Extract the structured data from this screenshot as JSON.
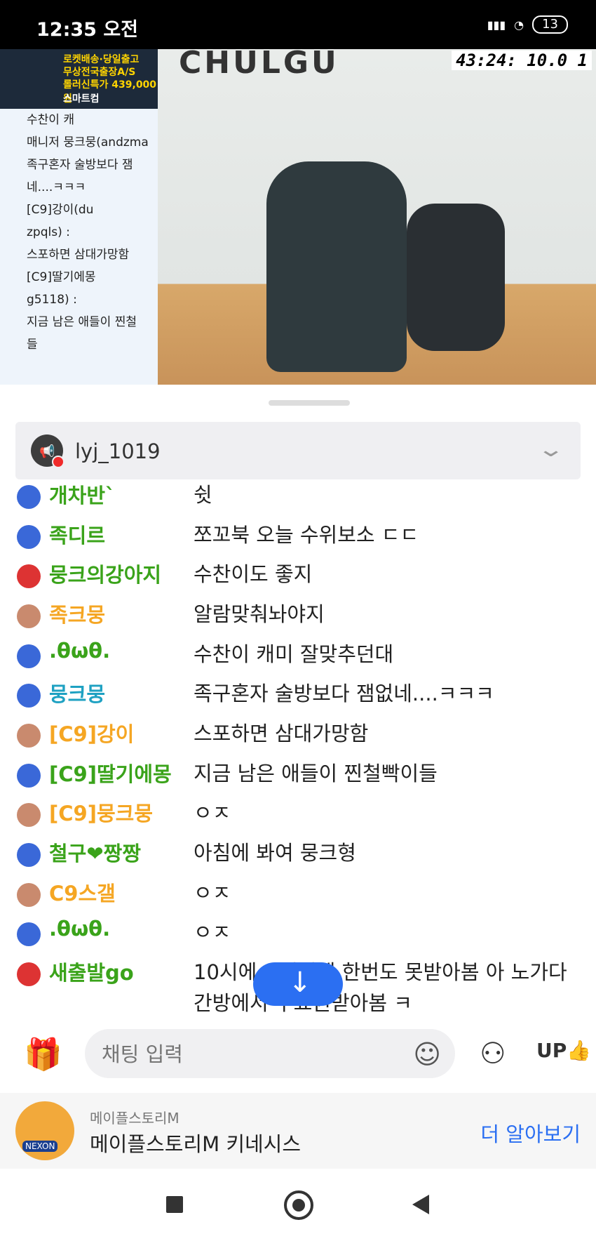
{
  "status": {
    "time": "12:35 오전",
    "battery": "13"
  },
  "video": {
    "ad_lines": [
      "로켓배송·당일출고",
      "무상전국출장A/S",
      "롤러신특가 439,000원",
      "스마트컴"
    ],
    "overlay_chat": [
      "수찬이 캐",
      "매니저 뭉크뭉(andzma",
      "족구혼자 술방보다 잼",
      "네....ㅋㅋㅋ",
      "[C9]강이(du",
      "zpqls) :",
      "스포하면 삼대가망함",
      "[C9]딸기에몽",
      "g5118) :",
      "지금 남은 애들이 찐철",
      "들"
    ],
    "brand": "CHULGU",
    "timer": "43:24: 10.0 1"
  },
  "owner": {
    "name": "lyj_1019"
  },
  "chat": [
    {
      "nick": "개차반`",
      "text": "쉿",
      "color": "#3aa31a",
      "icon": "#3a68d8"
    },
    {
      "nick": "족디르",
      "text": "쪼꼬북 오늘 수위보소 ㄷㄷ",
      "color": "#3aa31a",
      "icon": "#3a68d8"
    },
    {
      "nick": "뭉크의강아지",
      "text": "수찬이도 좋지",
      "color": "#3aa31a",
      "icon": "#d33"
    },
    {
      "nick": "족크뭉",
      "text": "알람맞춰놔야지",
      "color": "#f5a623",
      "icon": "#c98a6e"
    },
    {
      "nick": ".θωθ.",
      "text": "수찬이 캐미 잘맞추던대",
      "color": "#3aa31a",
      "icon": "#3a68d8"
    },
    {
      "nick": "뭉크뭉",
      "text": "족구혼자 술방보다 잼없네....ㅋㅋㅋ",
      "color": "#1ea1c2",
      "icon": "#3a68d8"
    },
    {
      "nick": "[C9]강이",
      "text": "스포하면 삼대가망함",
      "color": "#f5a623",
      "icon": "#c98a6e"
    },
    {
      "nick": "[C9]딸기에몽",
      "text": "지금 남은 애들이 찐철빡이들",
      "color": "#3aa31a",
      "icon": "#3a68d8"
    },
    {
      "nick": "[C9]뭉크뭉",
      "text": "ㅇㅈ",
      "color": "#f5a623",
      "icon": "#c98a6e"
    },
    {
      "nick": "철구❤짱짱",
      "text": "아침에 봐여 뭉크형",
      "color": "#3aa31a",
      "icon": "#3a68d8"
    },
    {
      "nick": "C9스갤",
      "text": "ㅇㅈ",
      "color": "#f5a623",
      "icon": "#c98a6e"
    },
    {
      "nick": ".θωθ.",
      "text": "ㅇㅈ",
      "color": "#3aa31a",
      "icon": "#3a68d8"
    },
    {
      "nick": "새출발go",
      "text": "10시에 O머니게 한번도 못받아봄 아 노가다간방에서 무료권받아봄 ㅋ",
      "color": "#3aa31a",
      "icon": "#d33"
    }
  ],
  "input": {
    "placeholder": "채팅 입력",
    "up_label": "UP"
  },
  "ad": {
    "small": "메이플스토리M",
    "title": "메이플스토리M 키네시스",
    "more": "더 알아보기",
    "logo_text": "NEXON"
  }
}
